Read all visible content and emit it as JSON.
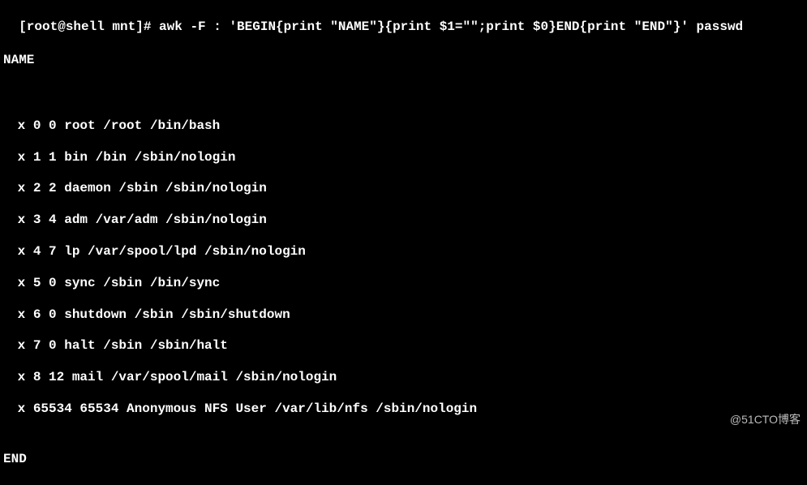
{
  "prompt": "[root@shell mnt]# ",
  "command": "awk -F : 'BEGIN{print \"NAME\"}{print $1=\"\";print $0}END{print \"END\"}' passwd",
  "header": "NAME",
  "entries": [
    " x 0 0 root /root /bin/bash",
    " x 1 1 bin /bin /sbin/nologin",
    " x 2 2 daemon /sbin /sbin/nologin",
    " x 3 4 adm /var/adm /sbin/nologin",
    " x 4 7 lp /var/spool/lpd /sbin/nologin",
    " x 5 0 sync /sbin /bin/sync",
    " x 6 0 shutdown /sbin /sbin/shutdown",
    " x 7 0 halt /sbin /sbin/halt",
    " x 8 12 mail /var/spool/mail /sbin/nologin",
    " x 65534 65534 Anonymous NFS User /var/lib/nfs /sbin/nologin"
  ],
  "footer": "END",
  "watermark": "@51CTO博客"
}
